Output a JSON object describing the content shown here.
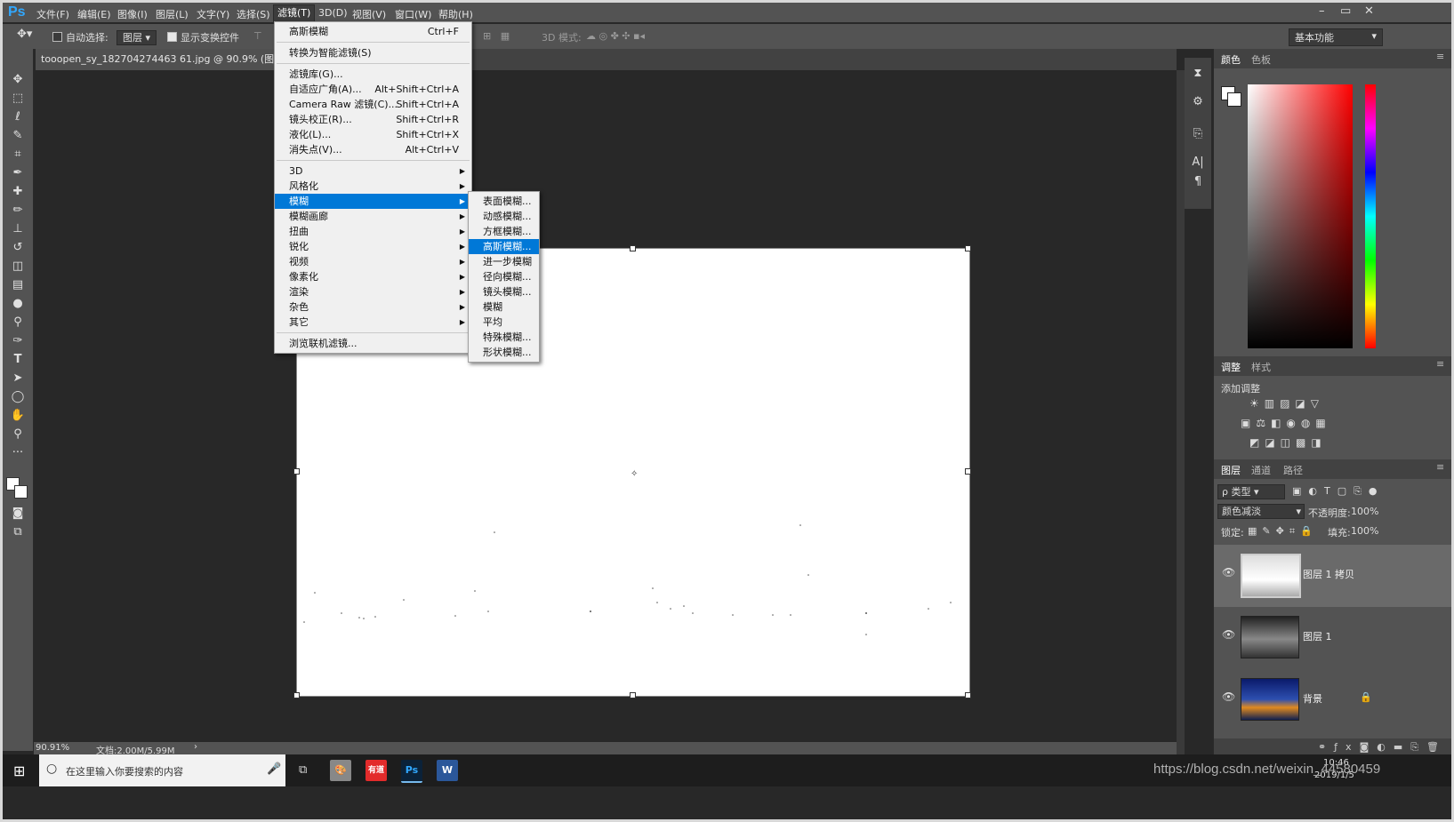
{
  "app": {
    "logo": "Ps",
    "menus": [
      "文件(F)",
      "编辑(E)",
      "图像(I)",
      "图层(L)",
      "文字(Y)",
      "选择(S)",
      "滤镜(T)",
      "3D(D)",
      "视图(V)",
      "窗口(W)",
      "帮助(H)"
    ],
    "active_menu": "滤镜(T)",
    "window_controls": [
      "–",
      "▭",
      "✕"
    ]
  },
  "options_bar": {
    "auto_select_label": "自动选择:",
    "auto_select_value": "图层",
    "show_transform_label": "显示变换控件",
    "mode_3d_label": "3D 模式:",
    "workspace": "基本功能"
  },
  "document": {
    "tab_title": "tooopen_sy_182704274463 61.jpg @ 90.9% (图层 1 拷贝, RG",
    "zoom": "90.91%",
    "doc_size": "文档:2.00M/5.99M"
  },
  "filter_menu": {
    "items": [
      {
        "label": "高斯模糊",
        "shortcut": "Ctrl+F"
      },
      {
        "sep": true
      },
      {
        "label": "转换为智能滤镜(S)"
      },
      {
        "sep": true
      },
      {
        "label": "滤镜库(G)..."
      },
      {
        "label": "自适应广角(A)...",
        "shortcut": "Alt+Shift+Ctrl+A"
      },
      {
        "label": "Camera Raw 滤镜(C)...",
        "shortcut": "Shift+Ctrl+A"
      },
      {
        "label": "镜头校正(R)...",
        "shortcut": "Shift+Ctrl+R"
      },
      {
        "label": "液化(L)...",
        "shortcut": "Shift+Ctrl+X"
      },
      {
        "label": "消失点(V)...",
        "shortcut": "Alt+Ctrl+V"
      },
      {
        "sep": true
      },
      {
        "label": "3D",
        "sub": true
      },
      {
        "label": "风格化",
        "sub": true
      },
      {
        "label": "模糊",
        "sub": true,
        "hl": true
      },
      {
        "label": "模糊画廊",
        "sub": true
      },
      {
        "label": "扭曲",
        "sub": true
      },
      {
        "label": "锐化",
        "sub": true
      },
      {
        "label": "视频",
        "sub": true
      },
      {
        "label": "像素化",
        "sub": true
      },
      {
        "label": "渲染",
        "sub": true
      },
      {
        "label": "杂色",
        "sub": true
      },
      {
        "label": "其它",
        "sub": true
      },
      {
        "sep": true
      },
      {
        "label": "浏览联机滤镜..."
      }
    ]
  },
  "blur_submenu": {
    "items": [
      "表面模糊...",
      "动感模糊...",
      "方框模糊...",
      "高斯模糊...",
      "进一步模糊",
      "径向模糊...",
      "镜头模糊...",
      "模糊",
      "平均",
      "特殊模糊...",
      "形状模糊..."
    ],
    "highlighted": "高斯模糊..."
  },
  "panels": {
    "color_tabs": [
      "颜色",
      "色板"
    ],
    "adjust_tabs": [
      "调整",
      "样式"
    ],
    "add_adjustment": "添加调整",
    "layers_tabs": [
      "图层",
      "通道",
      "路径"
    ],
    "kind_label": "ρ 类型",
    "blend_mode": "颜色减淡",
    "opacity_label": "不透明度:",
    "opacity_value": "100%",
    "lock_label": "锁定:",
    "fill_label": "填充:",
    "fill_value": "100%",
    "layers": [
      {
        "name": "图层 1 拷贝",
        "selected": true
      },
      {
        "name": "图层 1"
      },
      {
        "name": "背景",
        "locked": true
      }
    ],
    "colors": {
      "panel": "#535353",
      "accent": "#0078d7"
    }
  },
  "taskbar": {
    "search_placeholder": "在这里输入你要搜索的内容",
    "time": "10:46",
    "date": "2019/1/5"
  },
  "watermark": "https://blog.csdn.net/weixin_44580459"
}
